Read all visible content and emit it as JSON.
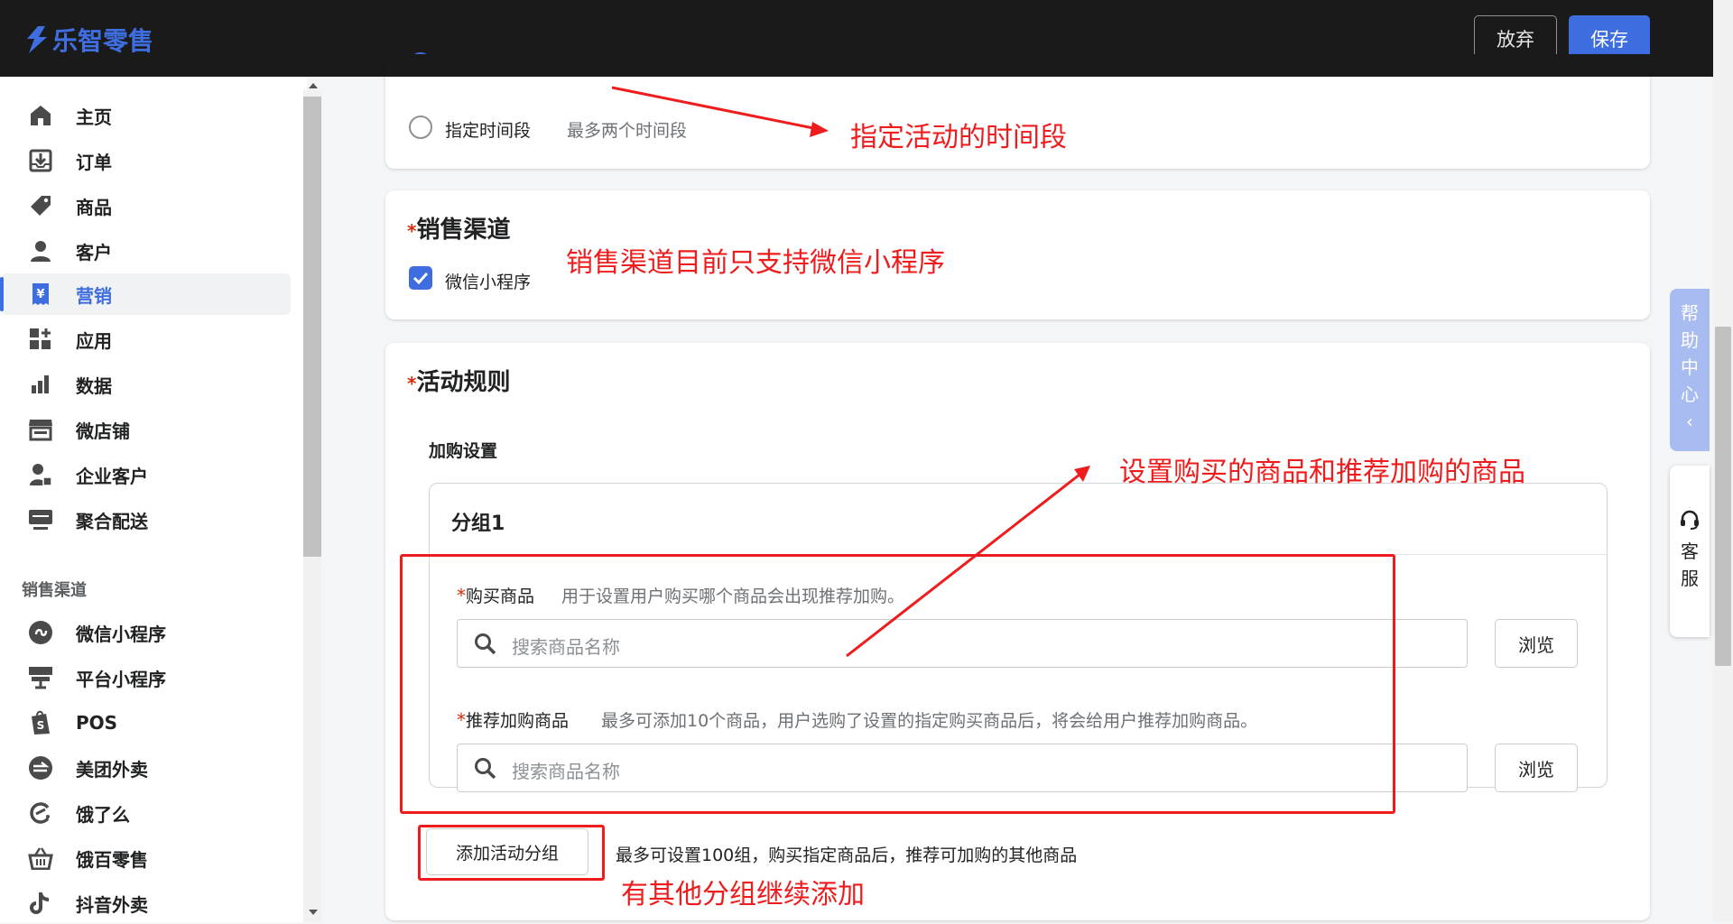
{
  "app": {
    "name": "乐智零售"
  },
  "toolbar": {
    "discard_label": "放弃",
    "save_label": "保存"
  },
  "sidebar": {
    "items": [
      {
        "label": "主页",
        "icon": "home-icon"
      },
      {
        "label": "订单",
        "icon": "download-tray-icon"
      },
      {
        "label": "商品",
        "icon": "tag-icon"
      },
      {
        "label": "客户",
        "icon": "user-icon"
      },
      {
        "label": "营销",
        "icon": "yen-receipt-icon",
        "active": true
      },
      {
        "label": "应用",
        "icon": "apps-icon"
      },
      {
        "label": "数据",
        "icon": "bar-chart-icon"
      },
      {
        "label": "微店铺",
        "icon": "store-icon"
      },
      {
        "label": "企业客户",
        "icon": "enterprise-user-icon"
      },
      {
        "label": "聚合配送",
        "icon": "monitor-icon"
      }
    ],
    "channels_title": "销售渠道",
    "channels": [
      {
        "label": "微信小程序",
        "icon": "mini-program-icon"
      },
      {
        "label": "平台小程序",
        "icon": "platform-icon"
      },
      {
        "label": "POS",
        "icon": "pos-bag-icon"
      },
      {
        "label": "美团外卖",
        "icon": "meituan-icon"
      },
      {
        "label": "饿了么",
        "icon": "eleme-icon"
      },
      {
        "label": "饿百零售",
        "icon": "basket-icon"
      },
      {
        "label": "抖音外卖",
        "icon": "douyin-icon"
      }
    ]
  },
  "time_section": {
    "option_specific": "指定时间段",
    "option_specific_hint": "最多两个时间段"
  },
  "channel_section": {
    "title": "销售渠道",
    "checkbox_label": "微信小程序"
  },
  "rules_section": {
    "title": "活动规则",
    "subtitle": "加购设置",
    "group_title": "分组1",
    "buy_label": "购买商品",
    "buy_hint": "用于设置用户购买哪个商品会出现推荐加购。",
    "search_placeholder": "搜索商品名称",
    "browse_label": "浏览",
    "rec_label": "推荐加购商品",
    "rec_hint": "最多可添加10个商品，用户选购了设置的指定购买商品后，将会给用户推荐加购商品。",
    "add_group_label": "添加活动分组",
    "add_group_hint": "最多可设置100组，购买指定商品后，推荐可加购的其他商品"
  },
  "annotations": {
    "time": "指定活动的时间段",
    "channel": "销售渠道目前只支持微信小程序",
    "products": "设置购买的商品和推荐加购的商品",
    "add": "有其他分组继续添加",
    "color": "#ee1c1c"
  },
  "floating": {
    "help_chars": [
      "帮",
      "助",
      "中",
      "心"
    ],
    "kefu_chars": [
      "客",
      "服"
    ]
  },
  "colors": {
    "accent": "#3e6de0",
    "topbar": "#1a1a1a",
    "required": "#d72c0d"
  }
}
